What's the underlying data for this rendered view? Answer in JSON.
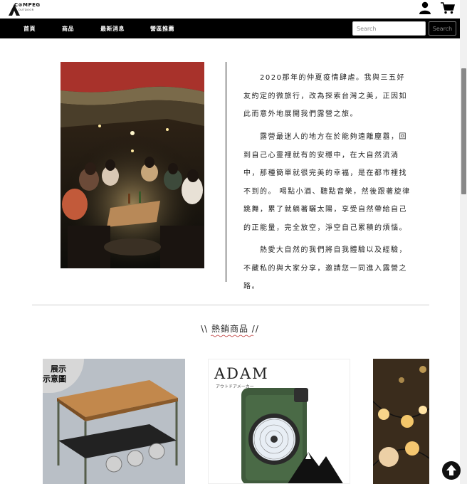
{
  "header": {
    "logo_text": "C⊗MPEG",
    "logo_sub": "OUTDOOR",
    "user_icon": "user-icon",
    "cart_icon": "cart-icon"
  },
  "nav": {
    "items": [
      "首頁",
      "商品",
      "最新消息",
      "營區推薦"
    ],
    "search_placeholder": "Search",
    "search_button": "Search"
  },
  "intro": {
    "paragraphs": [
      "　　2020那年的仲夏疫情肆虐。我與三五好友約定的微旅行，改為探索台灣之美，正因如此而意外地展開我們露營之旅。",
      "　　露營最迷人的地方在於能夠遠離塵囂，回到自己心靈裡就有的安穩中，在大自然流淌中，那種簡單就很完美的幸福，是在都市裡找不到的。 喝點小酒、聽點音樂，然後跟著旋律跳舞，累了就躺著曬太陽，享受自然帶給自己的正能量，完全放空，淨空自己累積的煩惱。",
      "　　熱愛大自然的我們將自我體驗以及經驗，不藏私的與大家分享，邀請您一同進入露營之路。"
    ]
  },
  "bestsellers": {
    "title": "\\\\ 熱銷商品 //",
    "cards": [
      {
        "badge_line1": "展示",
        "badge_line2": "示意圖"
      },
      {
        "brand": "ADAM",
        "brand_sub": "アウトドアメーカー"
      },
      {}
    ]
  },
  "colors": {
    "nav_bg": "#000000",
    "accent": "#c0392b"
  }
}
